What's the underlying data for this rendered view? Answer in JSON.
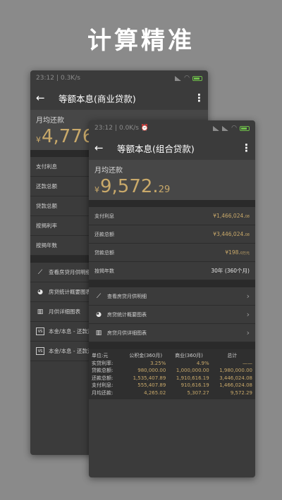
{
  "headline": "计算精准",
  "back_screen": {
    "status_time": "23:12",
    "status_speed": "0.3K/s",
    "title": "等额本息(商业贷款)",
    "monthly_label": "月均还款",
    "currency": "¥",
    "monthly_int": "4,776",
    "rows": [
      "支付利息",
      "还款总额",
      "贷款总额",
      "按揭利率",
      "按揭年数"
    ],
    "nav": [
      "查看房贷月供明细",
      "房贷统计概要图表",
      "月供详细图表",
      "本金/本息 - 还款对比",
      "本金/本息 - 还款对比"
    ]
  },
  "front_screen": {
    "status_time": "23:12",
    "status_speed": "0.0K/s",
    "title": "等额本息(组合贷款)",
    "monthly_label": "月均还款",
    "currency": "¥",
    "monthly_int": "9,572.",
    "monthly_dec": "29",
    "rows": [
      {
        "label": "支付利息",
        "value": "¥1,466,024.",
        "dec": "08"
      },
      {
        "label": "还款总额",
        "value": "¥3,446,024.",
        "dec": "08"
      },
      {
        "label": "贷款总额",
        "value": "¥198.",
        "dec": "0万元"
      },
      {
        "label": "按揭年数",
        "value": "30年 (360个月)",
        "dec": ""
      }
    ],
    "nav": [
      "查看房贷月供明细",
      "房贷统计概要图表",
      "房贷月供详细图表"
    ],
    "table": {
      "headers": [
        "单位:元",
        "公积金(360月)",
        "商业(360月)",
        "总计"
      ],
      "rows": [
        [
          "实贷利率:",
          "3.25%",
          "4.9%",
          "——"
        ],
        [
          "贷款总额:",
          "980,000.00",
          "1,000,000.00",
          "1,980,000.00"
        ],
        [
          "还款总额:",
          "1,535,407.89",
          "1,910,616.19",
          "3,446,024.08"
        ],
        [
          "支付利息:",
          "555,407.89",
          "910,616.19",
          "1,466,024.08"
        ],
        [
          "月均还款:",
          "4,265.02",
          "5,307.27",
          "9,572.29"
        ]
      ]
    }
  }
}
